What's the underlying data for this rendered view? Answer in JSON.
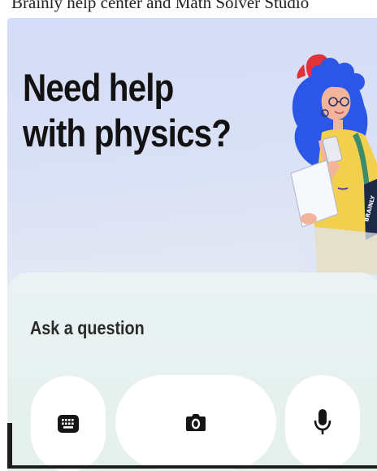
{
  "header_strip": {
    "clipped_text": "Brainly help center and Math Solver Studio"
  },
  "hero": {
    "line1": "Need help",
    "line2": "with physics?",
    "illustration_badge": "BRAINLY"
  },
  "ask": {
    "label": "Ask a question",
    "buttons": [
      {
        "name": "keyboard",
        "icon": "keyboard-icon"
      },
      {
        "name": "camera",
        "icon": "camera-icon"
      },
      {
        "name": "microphone",
        "icon": "microphone-icon"
      }
    ]
  },
  "colors": {
    "text_dark": "#121212",
    "panel_bg": "#e6f1ee",
    "hair_blue": "#2a57e8",
    "cap_red": "#e0323a",
    "skin": "#f2b49a"
  }
}
